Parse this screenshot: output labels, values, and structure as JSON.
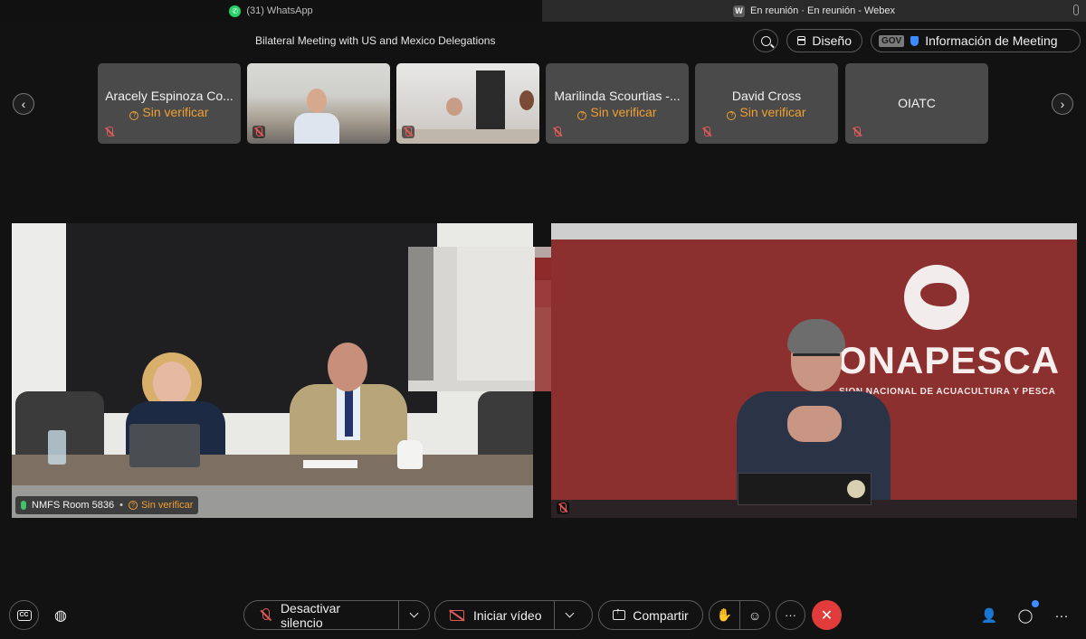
{
  "browser": {
    "tab_left_label": "(31) WhatsApp",
    "tab_right_label": "En reunión · En reunión - Webex",
    "tab_right_icon_letter": "W"
  },
  "header": {
    "meeting_title": "Bilateral Meeting with US and Mexico Delegations",
    "layout_label": "Diseño",
    "gov_badge": "GOV",
    "info_label": "Información de Meeting"
  },
  "strip": {
    "participants": [
      {
        "name": "Aracely Espinoza Co...",
        "status": "Sin verificar",
        "has_video": false,
        "muted": true
      },
      {
        "name": "",
        "status": "",
        "has_video": true,
        "muted": true
      },
      {
        "name": "",
        "status": "",
        "has_video": true,
        "muted": true
      },
      {
        "name": "Marilinda Scourtias -...",
        "status": "Sin verificar",
        "has_video": false,
        "muted": true
      },
      {
        "name": "David Cross",
        "status": "Sin verificar",
        "has_video": false,
        "muted": true
      },
      {
        "name": "OIATC",
        "status": "",
        "has_video": false,
        "muted": true
      }
    ]
  },
  "main": {
    "left_pane": {
      "room_name": "NMFS Room 5836",
      "status": "Sin verificar",
      "mic_active": true
    },
    "right_pane": {
      "brand_word": "ONAPESCA",
      "brand_subtitle": "SION NACIONAL DE ACUACULTURA Y PESCA",
      "muted": true
    }
  },
  "toolbar": {
    "unmute_label": "Desactivar silencio",
    "start_video_label": "Iniciar vídeo",
    "share_label": "Compartir",
    "more_label": "···",
    "end_label": "✕"
  },
  "colors": {
    "background": "#121212",
    "warning": "#f0a030",
    "muted_red": "#e05a5a",
    "end_call": "#e23b3b",
    "accent_blue": "#3d8bff"
  }
}
